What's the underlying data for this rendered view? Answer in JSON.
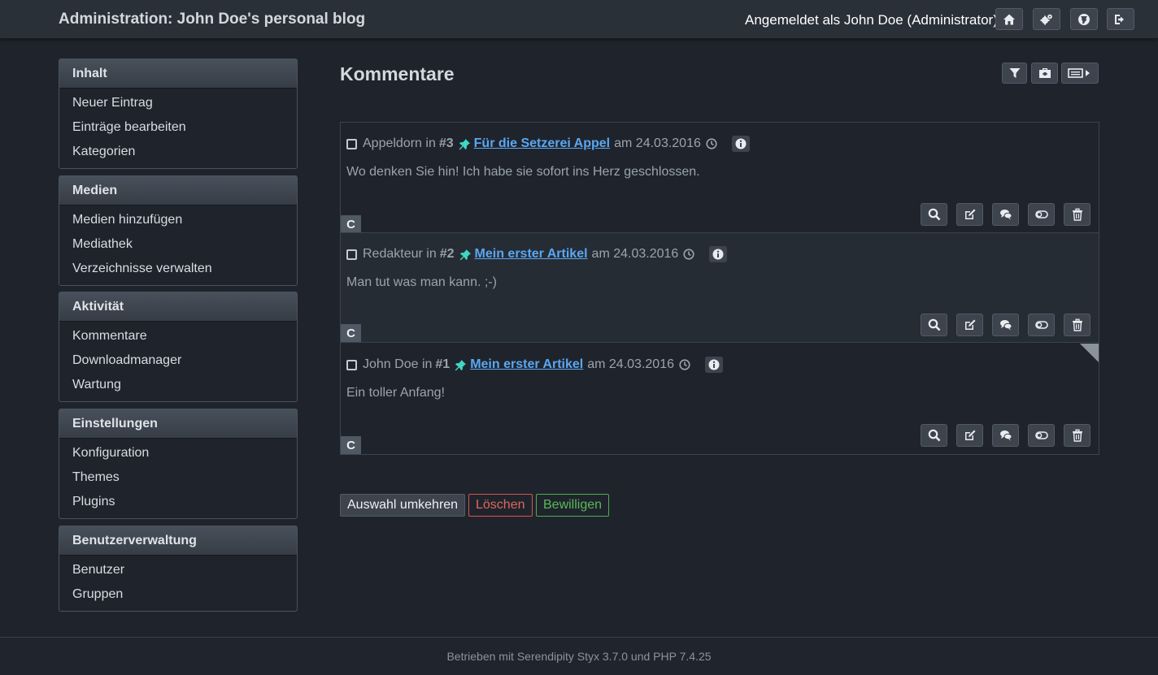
{
  "header": {
    "site_title": "Administration: John Doe's personal blog",
    "user_info": "Angemeldet als John Doe (Administrator)",
    "buttons": [
      "home-icon",
      "cogs-icon",
      "globe-icon",
      "logout-icon"
    ]
  },
  "sidebar": [
    {
      "title": "Inhalt",
      "items": [
        "Neuer Eintrag",
        "Einträge bearbeiten",
        "Kategorien"
      ]
    },
    {
      "title": "Medien",
      "items": [
        "Medien hinzufügen",
        "Mediathek",
        "Verzeichnisse verwalten"
      ]
    },
    {
      "title": "Aktivität",
      "items": [
        "Kommentare",
        "Downloadmanager",
        "Wartung"
      ]
    },
    {
      "title": "Einstellungen",
      "items": [
        "Konfiguration",
        "Themes",
        "Plugins"
      ]
    },
    {
      "title": "Benutzerverwaltung",
      "items": [
        "Benutzer",
        "Gruppen"
      ]
    }
  ],
  "main": {
    "title": "Kommentare",
    "toolbar": [
      "filter-icon",
      "toolbox-icon",
      "view-toggle-icon"
    ],
    "comments": [
      {
        "author": "Appeldorn",
        "in": "in",
        "num": "#3",
        "entry": "Für die Setzerei Appel",
        "am": "am",
        "date": "24.03.2016",
        "body": "Wo denken Sie hin! Ich habe sie sofort ins Herz geschlossen.",
        "badge": "C"
      },
      {
        "author": "Redakteur",
        "in": "in",
        "num": "#2",
        "entry": "Mein erster Artikel",
        "am": "am",
        "date": "24.03.2016",
        "body": "Man tut was man kann. ;-)",
        "badge": "C"
      },
      {
        "author": "John Doe",
        "in": "in",
        "num": "#1",
        "entry": "Mein erster Artikel",
        "am": "am",
        "date": "24.03.2016",
        "body": "Ein toller Anfang!",
        "badge": "C"
      }
    ],
    "bulk": {
      "invert": "Auswahl umkehren",
      "delete": "Löschen",
      "approve": "Bewilligen"
    }
  },
  "footer": {
    "text": "Betrieben mit Serendipity Styx 3.7.0 und PHP 7.4.25"
  },
  "colors": {
    "link": "#5aa7f2",
    "pin": "#3fd7c4",
    "delete": "#d9534f",
    "approve": "#5cb85c"
  }
}
